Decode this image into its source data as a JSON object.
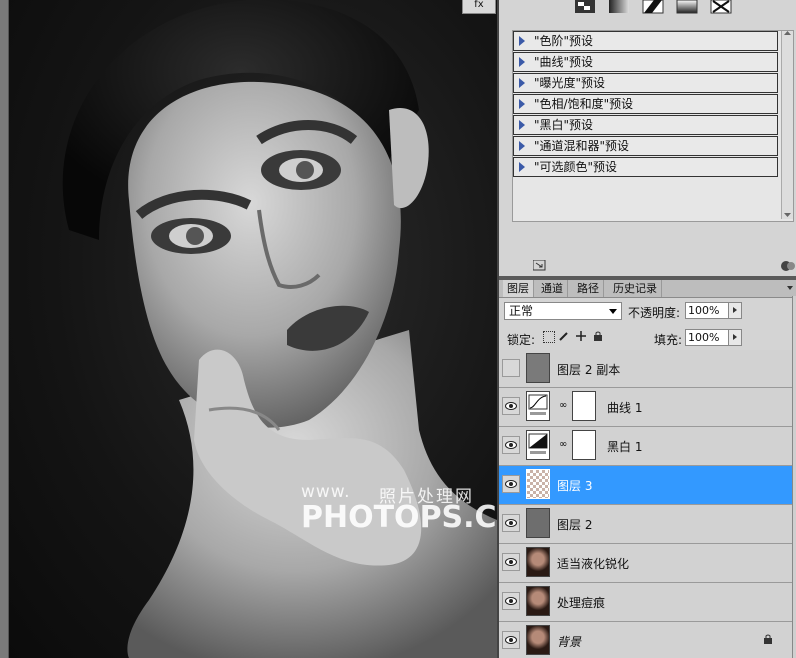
{
  "canvas": {
    "fx_label": "fx",
    "watermark_small_latin": "www.",
    "watermark_small_cn": "照片处理网",
    "watermark_large": "PHOTOPS.COM"
  },
  "adjustments": {
    "presets": [
      "\"色阶\"预设",
      "\"曲线\"预设",
      "\"曝光度\"预设",
      "\"色相/饱和度\"预设",
      "\"黑白\"预设",
      "\"通道混和器\"预设",
      "\"可选颜色\"预设"
    ]
  },
  "layers_panel": {
    "tabs": [
      "图层",
      "通道",
      "路径",
      "历史记录"
    ],
    "blend_mode": "正常",
    "opacity_label": "不透明度:",
    "opacity_value": "100%",
    "lock_label": "锁定:",
    "fill_label": "填充:",
    "fill_value": "100%",
    "layers": [
      {
        "name": "图层 2 副本",
        "visible": false,
        "selected": false,
        "kind": "pixel"
      },
      {
        "name": "曲线 1",
        "visible": true,
        "selected": false,
        "kind": "curves"
      },
      {
        "name": "黑白 1",
        "visible": true,
        "selected": false,
        "kind": "bw"
      },
      {
        "name": "图层 3",
        "visible": true,
        "selected": true,
        "kind": "transparent"
      },
      {
        "name": "图层 2",
        "visible": true,
        "selected": false,
        "kind": "pixel"
      },
      {
        "name": "适当液化锐化",
        "visible": true,
        "selected": false,
        "kind": "photo"
      },
      {
        "name": "处理痘痕",
        "visible": true,
        "selected": false,
        "kind": "photo"
      },
      {
        "name": "背景",
        "visible": true,
        "selected": false,
        "kind": "photo",
        "locked": true
      }
    ]
  },
  "colors": {
    "selection": "#3399ff",
    "preset_triangle": "#3b5aa8"
  }
}
